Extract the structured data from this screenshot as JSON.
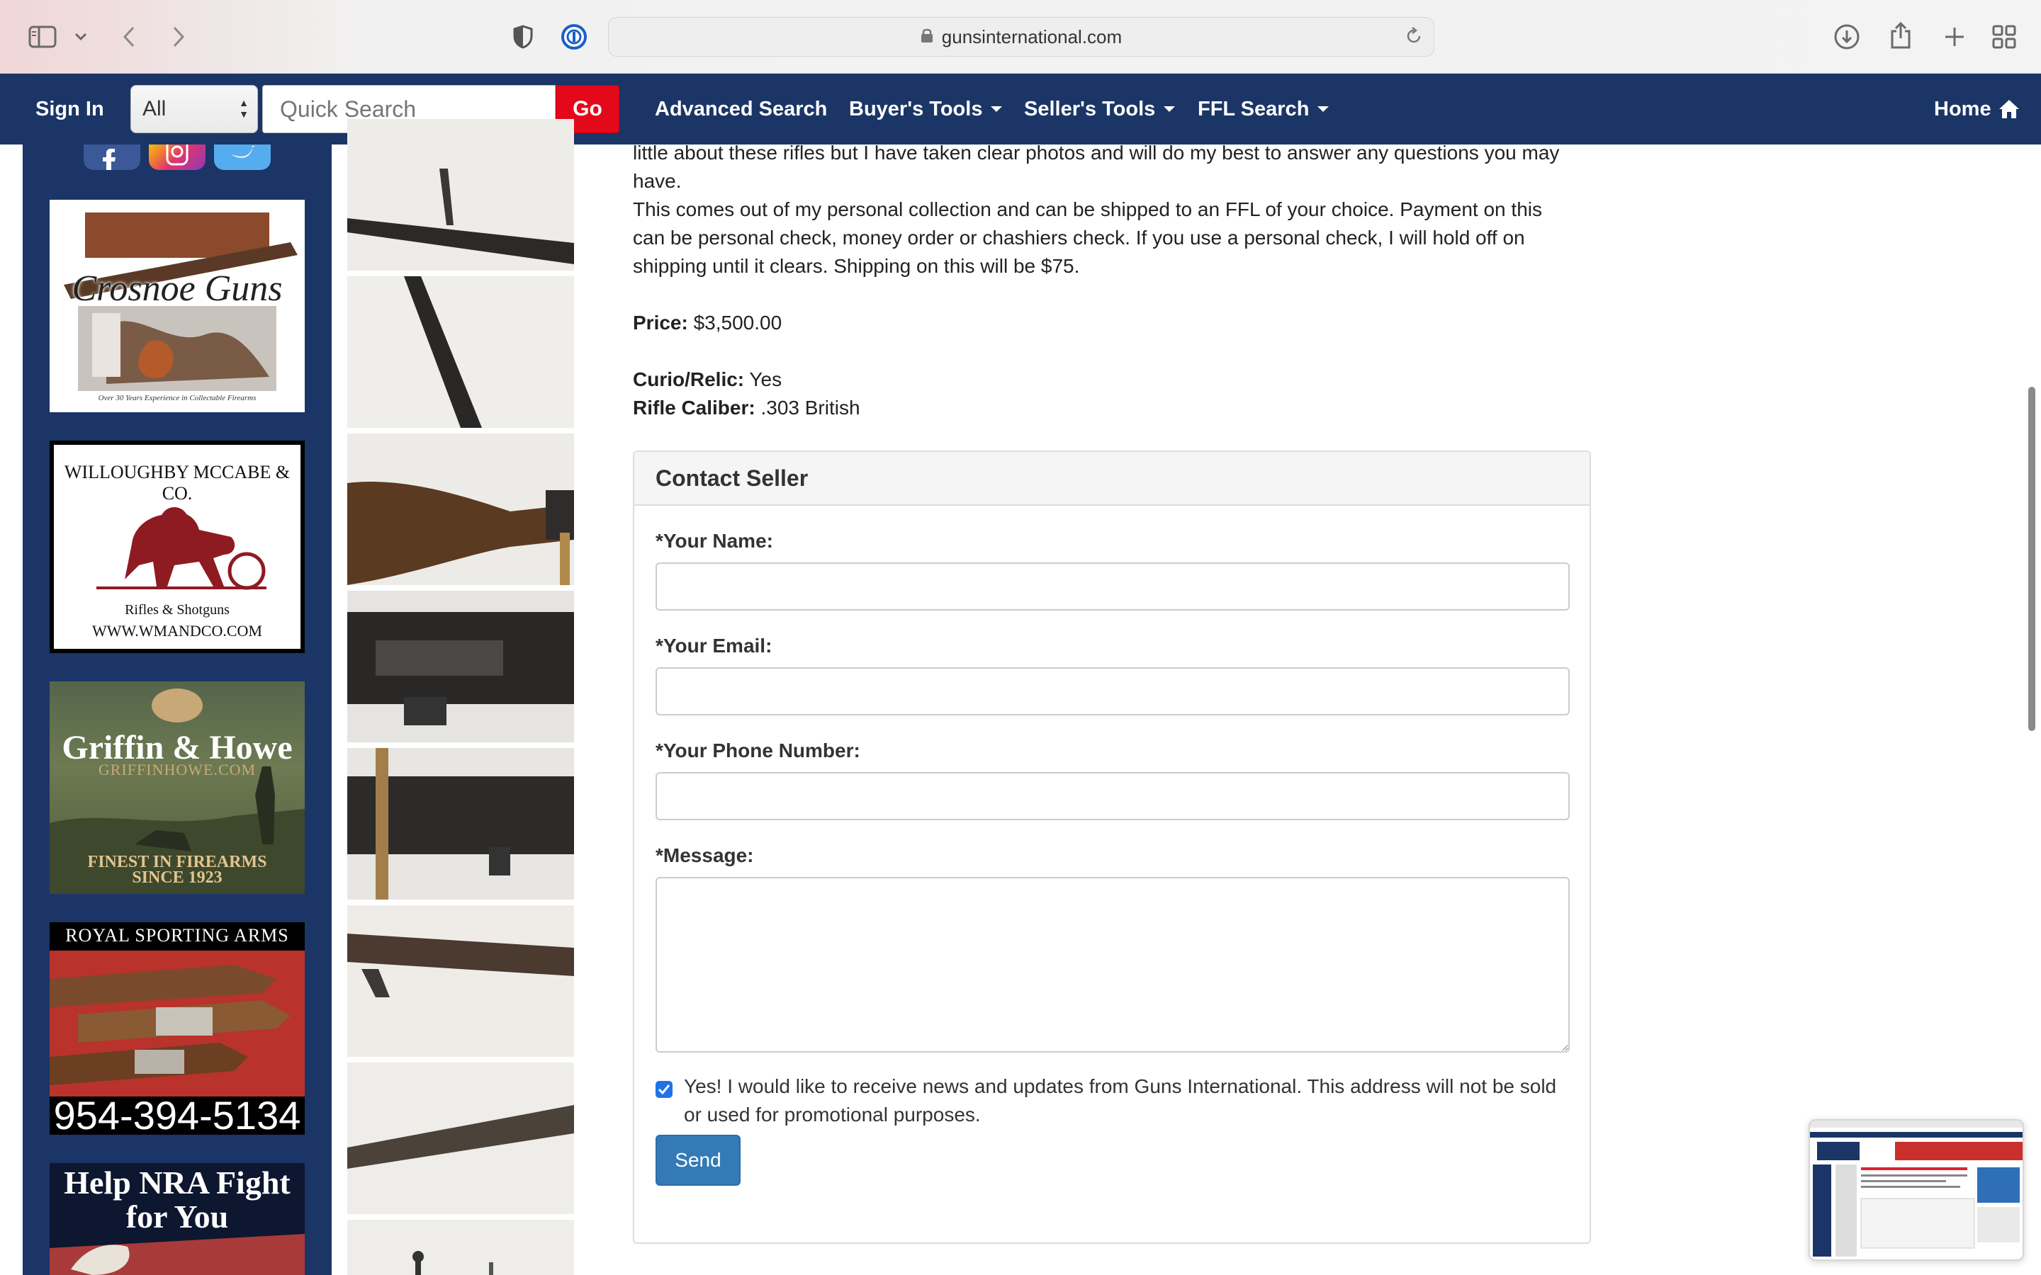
{
  "browser": {
    "url": "gunsinternational.com"
  },
  "nav": {
    "sign_in": "Sign In",
    "category_select": "All",
    "search_placeholder": "Quick Search",
    "go_label": "Go",
    "advanced_search": "Advanced Search",
    "buyers_tools": "Buyer's Tools",
    "sellers_tools": "Seller's Tools",
    "ffl_search": "FFL Search",
    "home": "Home"
  },
  "sidebar": {
    "ads": [
      {
        "text_main": "Crosnoe Guns",
        "text_sub": "Over 30 Years Experience in Collectable Firearms"
      },
      {
        "text_main": "WILLOUGHBY MCCABE & CO.",
        "text_sub": "Rifles & Shotguns",
        "text_url": "WWW.WMANDCO.COM"
      },
      {
        "text_main": "Griffin & Howe",
        "text_url": "GRIFFINHOWE.COM",
        "text_sub": "FINEST IN FIREARMS SINCE 1923"
      },
      {
        "text_main": "ROYAL SPORTING ARMS",
        "text_phone": "954-394-5134"
      },
      {
        "text_main": "Help NRA Fight for You"
      }
    ]
  },
  "listing": {
    "desc_line1": "little about these rifles but I have taken clear photos and will do my best to answer any questions you may",
    "desc_line2": "have.",
    "desc_line3": "This comes out of my personal collection and can be shipped to an FFL of your choice. Payment on this",
    "desc_line4": "can be personal check, money order or chashiers check. If you use a personal check, I will hold off on",
    "desc_line5": "shipping until it clears. Shipping on this will be $75.",
    "price_label": "Price:",
    "price_value": "$3,500.00",
    "curio_label": "Curio/Relic:",
    "curio_value": "Yes",
    "caliber_label": "Rifle Caliber:",
    "caliber_value": ".303 British"
  },
  "contact": {
    "title": "Contact Seller",
    "name_label": "*Your Name:",
    "email_label": "*Your Email:",
    "phone_label": "*Your Phone Number:",
    "message_label": "*Message:",
    "name_value": "",
    "email_value": "",
    "phone_value": "",
    "message_value": "",
    "newsletter_text": "Yes! I would like to receive news and updates from Guns International. This address will not be sold or used for promotional purposes.",
    "newsletter_checked": true,
    "send_label": "Send"
  },
  "colors": {
    "nav_bg": "#1b3566",
    "go_red": "#e3091a",
    "send_blue": "#337ab7",
    "checkbox_blue": "#1e73e8"
  }
}
